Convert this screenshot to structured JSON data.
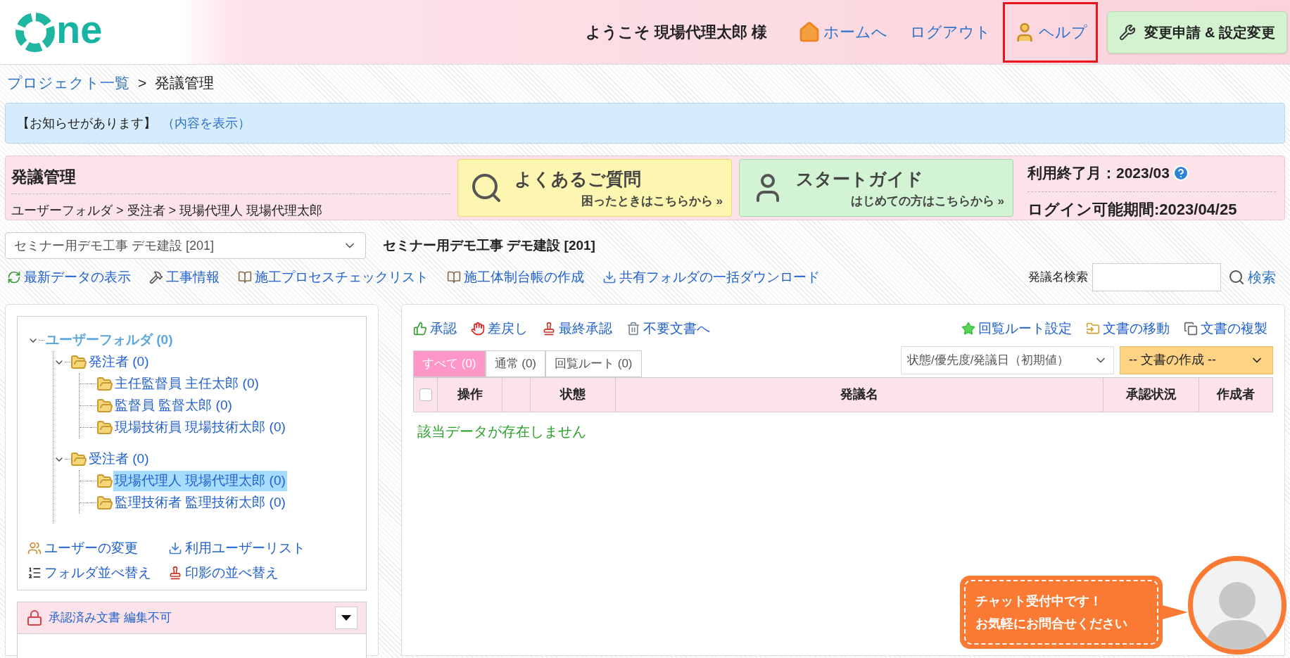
{
  "header": {
    "logo_text": "ne",
    "welcome": "ようこそ 現場代理太郎 様",
    "nav": [
      {
        "label": "ホームへ",
        "kind": "home",
        "highlighted": false
      },
      {
        "label": "ログアウト",
        "kind": "plain",
        "highlighted": false
      },
      {
        "label": "ヘルプ",
        "kind": "help",
        "highlighted": true
      }
    ],
    "settings_button": "変更申請 & 設定変更"
  },
  "breadcrumb": {
    "link": "プロジェクト一覧",
    "separator": ">",
    "current": "発議管理"
  },
  "notice": {
    "text": "【お知らせがあります】",
    "link": "（内容を表示）"
  },
  "page_header": {
    "title": "発議管理",
    "path": "ユーザーフォルダ > 受注者 > 現場代理人 現場代理太郎",
    "banners": [
      {
        "kind": "faq",
        "title": "よくあるご質問",
        "subtitle": "困ったときはこちらから »"
      },
      {
        "kind": "guide",
        "title": "スタートガイド",
        "subtitle": "はじめての方はこちらから »"
      }
    ],
    "expiry": "利用終了月：2023/03",
    "login_period": "ログイン可能期間:2023/04/25"
  },
  "project": {
    "select_value": "セミナー用デモ工事 デモ建設 [201]",
    "label": "セミナー用デモ工事 デモ建設 [201]"
  },
  "toolbar": {
    "items": [
      {
        "label": "最新データの表示",
        "kind": "refresh"
      },
      {
        "label": "工事情報",
        "kind": "tools"
      },
      {
        "label": "施工プロセスチェックリスト",
        "kind": "book"
      },
      {
        "label": "施工体制台帳の作成",
        "kind": "book"
      },
      {
        "label": "共有フォルダの一括ダウンロード",
        "kind": "download"
      }
    ],
    "search_label": "発議名検索",
    "search_button": "検索"
  },
  "tree": {
    "label": "ユーザーフォルダ (0)",
    "expanded": true,
    "selected": false,
    "children": [
      {
        "label": "発注者 (0)",
        "expanded": true,
        "selected": false,
        "children": [
          {
            "label": "主任監督員 主任太郎 (0)",
            "selected": false
          },
          {
            "label": "監督員 監督太郎 (0)",
            "selected": false
          },
          {
            "label": "現場技術員 現場技術太郎 (0)",
            "selected": false
          }
        ]
      },
      {
        "label": "受注者 (0)",
        "expanded": true,
        "selected": false,
        "children": [
          {
            "label": "現場代理人 現場代理太郎 (0)",
            "selected": true
          },
          {
            "label": "監理技術者 監理技術太郎 (0)",
            "selected": false
          }
        ]
      }
    ]
  },
  "left_actions": [
    {
      "label": "ユーザーの変更",
      "kind": "users"
    },
    {
      "label": "利用ユーザーリスト",
      "kind": "download"
    },
    {
      "label": "フォルダ並べ替え",
      "kind": "list"
    },
    {
      "label": "印影の並べ替え",
      "kind": "stamp"
    }
  ],
  "locked_section": {
    "label": "承認済み文書 編集不可"
  },
  "doc_actions_left": [
    {
      "label": "承認",
      "kind": "approve"
    },
    {
      "label": "差戻し",
      "kind": "reject"
    },
    {
      "label": "最終承認",
      "kind": "stamp"
    },
    {
      "label": "不要文書へ",
      "kind": "trash"
    }
  ],
  "doc_actions_right": [
    {
      "label": "回覧ルート設定",
      "kind": "star"
    },
    {
      "label": "文書の移動",
      "kind": "move"
    },
    {
      "label": "文書の複製",
      "kind": "copy"
    }
  ],
  "tabs": [
    {
      "label": "すべて (0)",
      "selected": true
    },
    {
      "label": "通常 (0)",
      "selected": false
    },
    {
      "label": "回覧ルート (0)",
      "selected": false
    }
  ],
  "sort_select": "状態/優先度/発議日（初期値）",
  "create_select": "-- 文書の作成 --",
  "table": {
    "select_all_checked": false,
    "columns": [
      "操作",
      "",
      "状態",
      "発議名",
      "承認状況",
      "作成者"
    ],
    "empty_message": "該当データが存在しません"
  },
  "chat": {
    "line1": "チャット受付中です！",
    "line2": "お気軽にお問合せください"
  }
}
